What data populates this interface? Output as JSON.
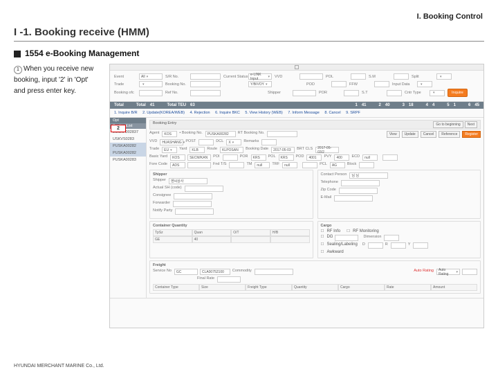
{
  "chapter": "I. Booking Control",
  "section_title": "I -1. Booking receive (HMM)",
  "subheading": "1554 e-Booking Management",
  "instruction": {
    "index": "1",
    "line1": "When you receive new",
    "line2": "booking, input '2' in 'Opt'",
    "line3": "and press enter key."
  },
  "filters": {
    "r1": {
      "c1": {
        "label": "Event",
        "value": "All"
      },
      "c2": {
        "label": "S/R No."
      },
      "c3": {
        "label": "Current Status",
        "value": "e-LINK Input"
      },
      "c4": {
        "label": "VVD"
      },
      "c5": {
        "label": "POL"
      },
      "c6": {
        "label": "S.M"
      },
      "c7": {
        "label": "Split"
      }
    },
    "r2": {
      "c1": {
        "label": "Trade"
      },
      "c2": {
        "label": "Booking No."
      },
      "c3": {
        "label": "",
        "value": "Y/B/VOY"
      },
      "c5": {
        "label": "POD"
      },
      "c6": {
        "label": "FFW"
      },
      "c7": {
        "label": "Input Data"
      }
    },
    "r3": {
      "c1": {
        "label": "Booking ofc"
      },
      "c2": {
        "label": "Ref No."
      },
      "c4": {
        "label": "Shipper"
      },
      "c5": {
        "label": "POR"
      },
      "c6": {
        "label": "S.T"
      },
      "c7": {
        "label": "Cntr Type"
      }
    },
    "inquire": "Inquire"
  },
  "totals": {
    "label": "Total",
    "items": [
      {
        "k": "Total",
        "v": "41"
      },
      {
        "k": "Total TEU",
        "v": "63"
      },
      {
        "k": "1",
        "v": "41"
      },
      {
        "k": "2",
        "v": "40"
      },
      {
        "k": "3",
        "v": "18"
      },
      {
        "k": "4",
        "v": "4"
      },
      {
        "k": "5",
        "v": "1"
      },
      {
        "k": "6",
        "v": "45"
      }
    ]
  },
  "menu": [
    "1. Inquire B/R",
    "2. Update(KOREA/WEB)",
    "4. Rejection",
    "6. Inquire BKC",
    "5. View History (WEB)",
    "7. Inform Message",
    "8. Cancel",
    "9. SRPF"
  ],
  "grid": {
    "opt_hdr": "Opt",
    "bkg_hdr": "BookingList",
    "opt_value": "2",
    "rows": [
      "EUSKA002837",
      "USKVS0283",
      "PUSKA00282",
      "PUSKA00282",
      "PUSKA00283"
    ]
  },
  "detail": {
    "title": "Booking Entry",
    "nav": [
      "Go to beginning",
      "Next"
    ],
    "top": [
      {
        "k": "Agent",
        "v": "KOS"
      },
      {
        "k": "• Booking No.",
        "v": "PUSKA00282"
      },
      {
        "k": "RT Booking No.",
        "v": ""
      }
    ],
    "topbtns": [
      "View",
      "Update",
      "Cancel",
      "Reference",
      "Register"
    ],
    "row1": [
      {
        "k": "VVD",
        "v": "HUASHANG"
      },
      {
        "k": "POST"
      },
      {
        "k": "DCL",
        "v": "X"
      },
      {
        "k": "Remarks"
      }
    ],
    "row2": [
      {
        "k": "Trade",
        "v": "EU"
      },
      {
        "k": "Yard",
        "v": "KLB"
      },
      {
        "k": "Route",
        "v": "KLPOSAN"
      },
      {
        "k": "Booking Date",
        "v": "2017-05-03"
      },
      {
        "k": "BRT CLS",
        "v": "2017-05-03/2"
      }
    ],
    "row3": [
      {
        "k": "Basic Yard",
        "v": "KOS",
        "v2": "SECM/KAN"
      },
      {
        "k": "POI"
      },
      {
        "k": "POR",
        "v": "KRS"
      },
      {
        "k": "POL",
        "v": "KRS"
      },
      {
        "k": "POD",
        "v": "4001"
      },
      {
        "k": "PVY",
        "v": "400"
      },
      {
        "k": "ECD",
        "v": "null"
      },
      {
        "k": ""
      }
    ],
    "row4": [
      {
        "k": "Fore Code",
        "v": "ADS"
      },
      {
        "k": "Fnd T/S"
      },
      {
        "k": "TM",
        "v": "null"
      },
      {
        "k": "TRF",
        "v": "null"
      },
      {
        "k": ""
      },
      {
        "k": "PCL",
        "v": "AG"
      },
      {
        "k": "Block"
      }
    ],
    "shipper": {
      "title": "Shipper",
      "f": [
        "Shipper",
        "Actual SH (code)",
        "Consignee",
        "Forwarder",
        "Notify Party"
      ],
      "v": [
        "엔씨상사"
      ]
    },
    "contact": {
      "f": [
        "Contact Person",
        "Telephone",
        "Zip Code",
        "E-Mail"
      ],
      "v": [
        "님 님"
      ]
    },
    "cntr": {
      "title": "Container Quantity",
      "cols": [
        "TpSz",
        "Quan",
        "O/T",
        "H/B"
      ],
      "row": [
        "GE",
        "40"
      ]
    },
    "cargo": {
      "title": "Cargo",
      "f": [
        "RF Info",
        "RF Monitoring",
        "DG",
        "Dimension",
        "Sealing/Labeling",
        "D",
        "R",
        "Y",
        "Awkward"
      ]
    },
    "freight": {
      "title": "Freight",
      "f": [
        "Service No",
        "Commodity",
        "Auto Rating",
        "Final Rate"
      ],
      "v": [
        "GC",
        "CLA00752100",
        "Auto Rating"
      ],
      "cols": [
        "Container Type",
        "Size",
        "Freight Type",
        "Quantity",
        "Cargo",
        "Rate",
        "Amount"
      ]
    }
  },
  "footer": "HYUNDAI MERCHANT MARINE Co., Ltd."
}
